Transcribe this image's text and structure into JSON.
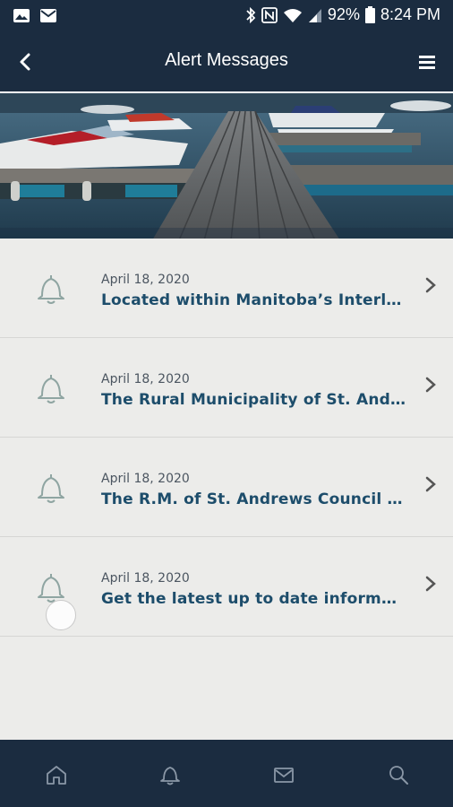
{
  "status_bar": {
    "battery": "92%",
    "time": "8:24 PM",
    "icons": [
      "image-icon",
      "mail-icon",
      "bluetooth-icon",
      "nfc-icon",
      "wifi-icon",
      "signal-icon",
      "battery-icon"
    ]
  },
  "header": {
    "title": "Alert Messages",
    "back_icon": "chevron-left-icon",
    "menu_icon": "hamburger-menu-icon"
  },
  "alerts": [
    {
      "date": "April 18, 2020",
      "text": "Located within Manitoba’s Interlake region, the Rural Municipality of St. Andrews"
    },
    {
      "date": "April 18, 2020",
      "text": "The Rural Municipality of St. Andrews welcomes you"
    },
    {
      "date": "April 18, 2020",
      "text": "The R.M. of St. Andrews Council is elected"
    },
    {
      "date": "April 18, 2020",
      "text": "Get the latest up to date information"
    }
  ],
  "bottom_nav": [
    {
      "name": "home",
      "icon": "home-icon"
    },
    {
      "name": "alerts",
      "icon": "bell-icon"
    },
    {
      "name": "messages",
      "icon": "mail-icon"
    },
    {
      "name": "search",
      "icon": "search-icon"
    }
  ],
  "colors": {
    "bar": "#1b2c40",
    "accent_text": "#1d4d6b",
    "background": "#ececea"
  }
}
